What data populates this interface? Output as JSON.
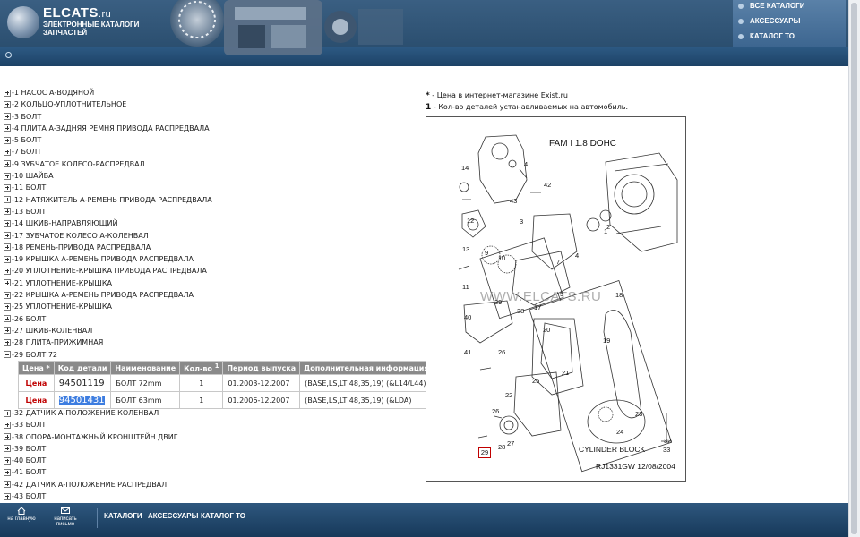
{
  "header": {
    "brand_name": "ELCATS",
    "brand_tld": ".ru",
    "brand_sub": "ЭЛЕКТРОННЫЕ КАТАЛОГИ ЗАПЧАСТЕЙ",
    "top_nav": [
      "ВСЕ КАТАЛОГИ",
      "АКСЕССУАРЫ",
      "КАТАЛОГ ТО"
    ]
  },
  "tree": [
    {
      "label": "1 НАСОС А-ВОДЯНОЙ",
      "expanded": false
    },
    {
      "label": "2 КОЛЬЦО-УПЛОТНИТЕЛЬНОЕ",
      "expanded": false
    },
    {
      "label": "3 БОЛТ",
      "expanded": false
    },
    {
      "label": "4 ПЛИТА А-ЗАДНЯЯ РЕМНЯ ПРИВОДА РАСПРЕДВАЛА",
      "expanded": false
    },
    {
      "label": "5 БОЛТ",
      "expanded": false
    },
    {
      "label": "7 БОЛТ",
      "expanded": false
    },
    {
      "label": "9 ЗУБЧАТОЕ КОЛЕСО-РАСПРЕДВАЛ",
      "expanded": false
    },
    {
      "label": "10 ШАЙБА",
      "expanded": false
    },
    {
      "label": "11 БОЛТ",
      "expanded": false
    },
    {
      "label": "12 НАТЯЖИТЕЛЬ А-РЕМЕНЬ ПРИВОДА РАСПРЕДВАЛА",
      "expanded": false
    },
    {
      "label": "13 БОЛТ",
      "expanded": false
    },
    {
      "label": "14 ШКИВ-НАПРАВЛЯЮЩИЙ",
      "expanded": false
    },
    {
      "label": "17 ЗУБЧАТОЕ КОЛЕСО А-КОЛЕНВАЛ",
      "expanded": false
    },
    {
      "label": "18 РЕМЕНЬ-ПРИВОДА РАСПРЕДВАЛА",
      "expanded": false
    },
    {
      "label": "19 КРЫШКА А-РЕМЕНЬ ПРИВОДА РАСПРЕДВАЛА",
      "expanded": false
    },
    {
      "label": "20 УПЛОТНЕНИЕ-КРЫШКА ПРИВОДА РАСПРЕДВАЛА",
      "expanded": false
    },
    {
      "label": "21 УПЛОТНЕНИЕ-КРЫШКА",
      "expanded": false
    },
    {
      "label": "22 КРЫШКА А-РЕМЕНЬ ПРИВОДА РАСПРЕДВАЛА",
      "expanded": false
    },
    {
      "label": "25 УПЛОТНЕНИЕ-КРЫШКА",
      "expanded": false
    },
    {
      "label": "26 БОЛТ",
      "expanded": false
    },
    {
      "label": "27 ШКИВ-КОЛЕНВАЛ",
      "expanded": false
    },
    {
      "label": "28 ПЛИТА-ПРИЖИМНАЯ",
      "expanded": false
    },
    {
      "label": "29 БОЛТ 72",
      "expanded": true
    }
  ],
  "tree_after": [
    {
      "label": "32 ДАТЧИК А-ПОЛОЖЕНИЕ КОЛЕНВАЛ",
      "expanded": false
    },
    {
      "label": "33 БОЛТ",
      "expanded": false
    },
    {
      "label": "38 ОПОРА-МОНТАЖНЫЙ КРОНШТЕЙН ДВИГ",
      "expanded": false
    },
    {
      "label": "39 БОЛТ",
      "expanded": false
    },
    {
      "label": "40 БОЛТ",
      "expanded": false
    },
    {
      "label": "41 БОЛТ",
      "expanded": false
    },
    {
      "label": "42 ДАТЧИК А-ПОЛОЖЕНИЕ РАСПРЕДВАЛ",
      "expanded": false
    },
    {
      "label": "43 БОЛТ",
      "expanded": false
    }
  ],
  "parts_table": {
    "headers": [
      "Цена *",
      "Код детали",
      "Наименование",
      "Кол-во",
      "Период выпуска",
      "Дополнительная информация"
    ],
    "qty_sup": "1",
    "rows": [
      {
        "price": "Цена",
        "code": "94501119",
        "name": "БОЛТ 72mm",
        "qty": "1",
        "period": "01.2003-12.2007",
        "info": "(BASE,LS,LT 48,35,19) (&L14/L44)",
        "selected": false
      },
      {
        "price": "Цена",
        "code": "94501431",
        "name": "БОЛТ 63mm",
        "qty": "1",
        "period": "01.2006-12.2007",
        "info": "(BASE,LS,LT 48,35,19) (&LDA)",
        "selected": true
      }
    ]
  },
  "legend": {
    "star_mark": "*",
    "star_text": "- Цена в интернет-магазине Exist.ru",
    "num_mark": "1",
    "num_text": "- Кол-во деталей устанавливаемых на автомобиль."
  },
  "diagram": {
    "engine_label": "FAM I  1.8 DOHC",
    "watermark": "WWW.ELCATS.RU",
    "cylinder_label": "CYLINDER BLOCK",
    "footer_code": "RJ1331GW  12/08/2004",
    "highlighted_callout": "29",
    "callouts": [
      "18",
      "4",
      "14",
      "42",
      "43",
      "3",
      "1",
      "2",
      "12",
      "13",
      "9",
      "10",
      "4",
      "7",
      "11",
      "5",
      "17",
      "39",
      "38",
      "40",
      "41",
      "20",
      "19",
      "26",
      "21",
      "25",
      "22",
      "23",
      "26",
      "27",
      "28",
      "24",
      "32",
      "33"
    ]
  },
  "footer": {
    "home_label": "на главную",
    "mail_label": "написать письмо",
    "links": [
      "КАТАЛОГИ",
      "АКСЕССУАРЫ",
      "КАТАЛОГ ТО"
    ]
  },
  "colors": {
    "header_blue": "#2d5a84",
    "price_red": "#c00000",
    "selection_blue": "#3d7de0",
    "table_header_gray": "#8a8a8a"
  }
}
